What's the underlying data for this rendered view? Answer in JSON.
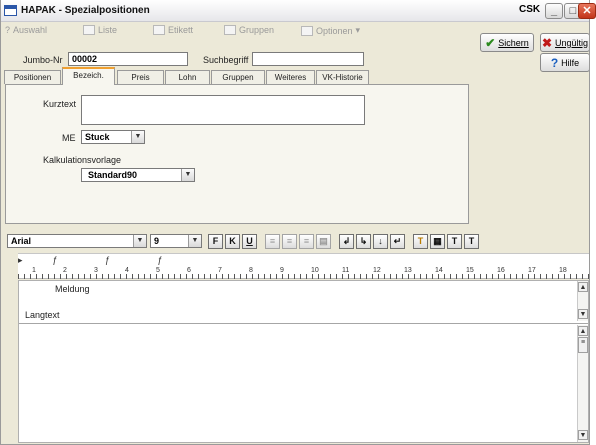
{
  "window": {
    "title": "HAPAK - Spezialpositionen",
    "user": "CSK"
  },
  "toolbar": {
    "items": [
      "Auswahl",
      "Liste",
      "Etikett",
      "Gruppen",
      "Optionen"
    ],
    "help_marker": "?"
  },
  "actions": {
    "save": "Sichern",
    "undo": "Ungültig",
    "help": "Hilfe"
  },
  "fields": {
    "jumbo_label": "Jumbo-Nr",
    "jumbo_value": "00002",
    "search_label": "Suchbegriff",
    "search_value": ""
  },
  "tabs": [
    "Positionen",
    "Bezeich.",
    "Preis",
    "Lohn",
    "Gruppen",
    "Weiteres",
    "VK-Historie"
  ],
  "active_tab": "Bezeich.",
  "bezeichnung": {
    "kurztext_label": "Kurztext",
    "kurztext_value": "",
    "me_label": "ME",
    "me_value": "Stuck",
    "kalk_label": "Kalkulationsvorlage",
    "kalk_value": "Standard90"
  },
  "format": {
    "font": "Arial",
    "size": "9",
    "bold": "F",
    "italic": "K",
    "underline": "U"
  },
  "ruler": {
    "numbers": [
      "1",
      "2",
      "3",
      "4",
      "5",
      "6",
      "7",
      "8",
      "9",
      "10",
      "11",
      "12",
      "13",
      "14",
      "15",
      "16",
      "17",
      "18"
    ]
  },
  "memo": {
    "meldung_label": "Meldung",
    "langtext_label": "Langtext"
  }
}
